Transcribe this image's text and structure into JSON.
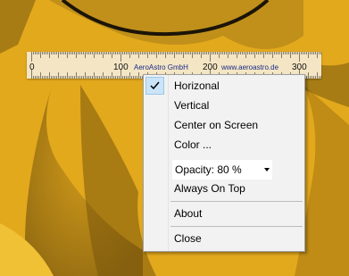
{
  "ruler": {
    "ticks": [
      "0",
      "100",
      "200",
      "300"
    ],
    "company": "AeroAstro GmbH",
    "website": "www.aeroastro.de"
  },
  "menu": {
    "items": [
      {
        "label": "Horizonal",
        "checked": true
      },
      {
        "label": "Vertical"
      },
      {
        "label": "Center on Screen"
      },
      {
        "label": "Color ..."
      },
      {
        "label": "Always On Top"
      },
      {
        "label": "About"
      },
      {
        "label": "Close"
      }
    ],
    "opacity": {
      "value": "Opacity: 80 %",
      "options": [
        "Opacity: 80 %"
      ]
    }
  },
  "colors": {
    "background": "#e3a91c",
    "ruler": "#f4e6c4",
    "menu": "#f2f2f2",
    "check_highlight": "#cce4f7",
    "ruler_text": "#1a2b8c"
  }
}
